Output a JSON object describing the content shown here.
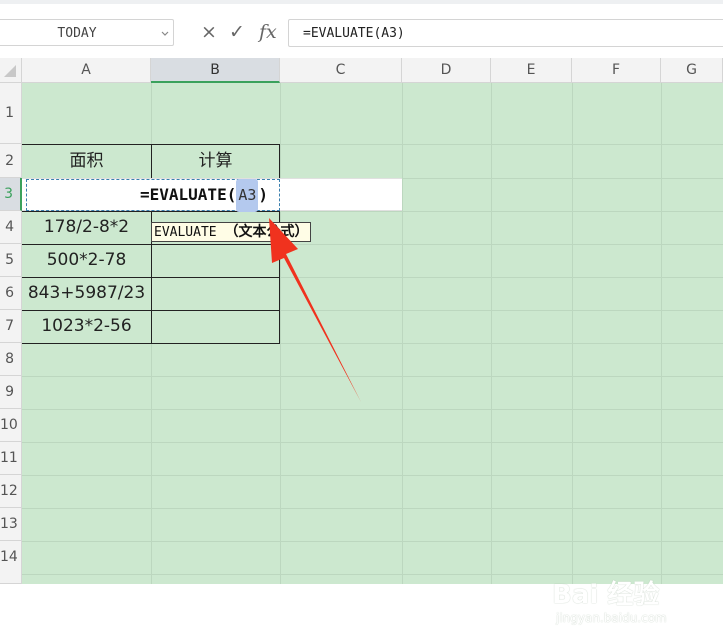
{
  "formula_bar": {
    "name_box": "TODAY",
    "cancel_icon": "×",
    "enter_icon": "✓",
    "fx_icon": "fx",
    "formula": "=EVALUATE(A3)"
  },
  "columns": [
    "A",
    "B",
    "C",
    "D",
    "E",
    "F",
    "G"
  ],
  "rows": [
    "1",
    "2",
    "3",
    "4",
    "5",
    "6",
    "7",
    "8",
    "9",
    "10",
    "11",
    "12",
    "13",
    "14"
  ],
  "table": {
    "header_a": "面积",
    "header_b": "计算",
    "a4": "178/2-8*2",
    "a5": "500*2-78",
    "a6": "843+5987/23",
    "a7": "1023*2-56"
  },
  "editing": {
    "prefix": "=EVALUATE(",
    "ref": "A3",
    "suffix": ")"
  },
  "tooltip": {
    "func": "EVALUATE",
    "args": "（文本公式）"
  },
  "watermark": {
    "main": "Bai 经验",
    "sub": "jingyan.baidu.com"
  },
  "colors": {
    "grid_bg": "#cce8cf",
    "selection": "#3aa15c",
    "arrow": "#f0321e",
    "ref_highlight": "#b4c9ee"
  }
}
